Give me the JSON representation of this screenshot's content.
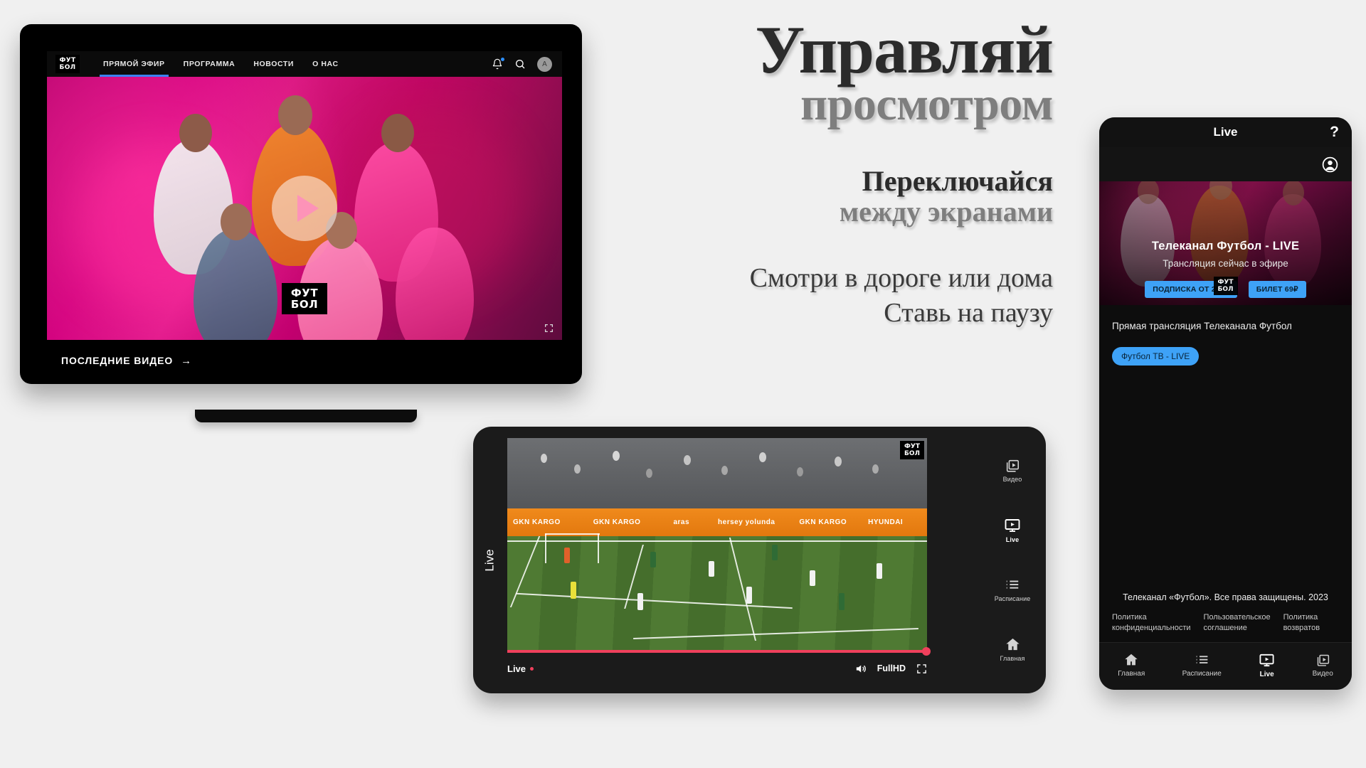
{
  "laptop": {
    "logo": {
      "line1": "ФУТ",
      "line2": "БОЛ"
    },
    "nav": [
      {
        "label": "ПРЯМОЙ ЭФИР",
        "active": true
      },
      {
        "label": "ПРОГРАММА",
        "active": false
      },
      {
        "label": "НОВОСТИ",
        "active": false
      },
      {
        "label": "О НАС",
        "active": false
      }
    ],
    "actions": {
      "bell_icon": "bell-icon",
      "search_icon": "search-icon",
      "avatar_initial": "A"
    },
    "hero": {
      "watermark_line1": "ФУТ",
      "watermark_line2": "БОЛ",
      "play_icon": "play-icon",
      "fullscreen_icon": "fullscreen-icon"
    },
    "latest": {
      "label": "ПОСЛЕДНИЕ ВИДЕО",
      "arrow": "→"
    }
  },
  "headline": {
    "line1": "Управляй",
    "line2": "просмотром",
    "line3": "Переключайся",
    "line4": "между экранами",
    "line5": "Смотри в дороге или дома",
    "line6": "Ставь на паузу"
  },
  "tablet": {
    "side_label": "Live",
    "video": {
      "corner_logo_line1": "ФУТ",
      "corner_logo_line2": "БОЛ",
      "boards": [
        "GKN KARGO",
        "HYUNDAI",
        "GKN KARGO",
        "aras",
        "GKN KARGO",
        "hersey yolunda",
        "GKN KARGO"
      ]
    },
    "controls": {
      "live_label": "Live",
      "quality": "FullHD",
      "volume_icon": "volume-icon",
      "fullscreen_icon": "fullscreen-icon"
    },
    "rail": [
      {
        "label": "Видео",
        "icon": "video-stack-icon",
        "active": false
      },
      {
        "label": "Live",
        "icon": "live-tv-icon",
        "active": true
      },
      {
        "label": "Расписание",
        "icon": "list-icon",
        "active": false
      },
      {
        "label": "Главная",
        "icon": "home-icon",
        "active": false
      }
    ]
  },
  "phone": {
    "header": {
      "title": "Live",
      "help": "?",
      "account_icon": "account-circle-icon"
    },
    "hero": {
      "title": "Телеканал Футбол - LIVE",
      "subtitle": "Трансляция сейчас в эфире",
      "button_primary": "ПОДПИСКА ОТ 250₽",
      "button_secondary": "БИЛЕТ 69₽",
      "watermark_line1": "ФУТ",
      "watermark_line2": "БОЛ"
    },
    "body": {
      "section_title": "Прямая трансляция Телеканала Футбол",
      "chip": "Футбол ТВ - LIVE"
    },
    "footer": {
      "copyright": "Телеканал «Футбол». Все права защищены. 2023",
      "links": [
        "Политика конфиденциальности",
        "Пользовательское соглашение",
        "Политика возвратов"
      ]
    },
    "nav": [
      {
        "label": "Главная",
        "icon": "home-icon",
        "active": false
      },
      {
        "label": "Расписание",
        "icon": "list-icon",
        "active": false
      },
      {
        "label": "Live",
        "icon": "live-tv-icon",
        "active": true
      },
      {
        "label": "Видео",
        "icon": "video-stack-icon",
        "active": false
      }
    ]
  },
  "colors": {
    "accent_blue": "#3ea2f7",
    "nav_active": "#3b82f6",
    "live_red": "#f0405c",
    "page_bg": "#f0f0f0"
  }
}
